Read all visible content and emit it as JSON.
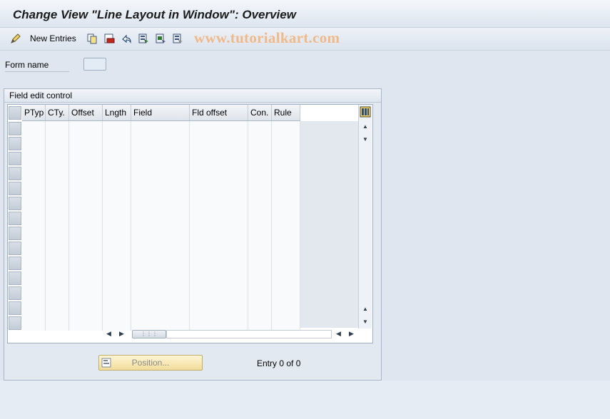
{
  "window": {
    "title": "Change View \"Line Layout in Window\": Overview"
  },
  "toolbar": {
    "new_entries_label": "New Entries",
    "icons": [
      "edit-pen-icon",
      "copy-icon",
      "delete-icon",
      "undo-icon",
      "select-all-icon",
      "select-block-icon",
      "deselect-all-icon"
    ]
  },
  "watermark": {
    "text": "www.tutorialkart.com",
    "color": "#f0b98a"
  },
  "form": {
    "form_name_label": "Form name",
    "form_name_value": ""
  },
  "group": {
    "title": "Field edit control"
  },
  "table": {
    "columns": [
      {
        "key": "ptyp",
        "label": "PTyp"
      },
      {
        "key": "cty",
        "label": "CTy."
      },
      {
        "key": "offset",
        "label": "Offset"
      },
      {
        "key": "lngth",
        "label": "Lngth"
      },
      {
        "key": "field",
        "label": "Field"
      },
      {
        "key": "fld_offset",
        "label": "Fld offset"
      },
      {
        "key": "con",
        "label": "Con."
      },
      {
        "key": "rule",
        "label": "Rule"
      }
    ],
    "rows": [
      [
        "",
        "",
        "",
        "",
        "",
        "",
        "",
        ""
      ],
      [
        "",
        "",
        "",
        "",
        "",
        "",
        "",
        ""
      ],
      [
        "",
        "",
        "",
        "",
        "",
        "",
        "",
        ""
      ],
      [
        "",
        "",
        "",
        "",
        "",
        "",
        "",
        ""
      ],
      [
        "",
        "",
        "",
        "",
        "",
        "",
        "",
        ""
      ],
      [
        "",
        "",
        "",
        "",
        "",
        "",
        "",
        ""
      ],
      [
        "",
        "",
        "",
        "",
        "",
        "",
        "",
        ""
      ],
      [
        "",
        "",
        "",
        "",
        "",
        "",
        "",
        ""
      ],
      [
        "",
        "",
        "",
        "",
        "",
        "",
        "",
        ""
      ],
      [
        "",
        "",
        "",
        "",
        "",
        "",
        "",
        ""
      ],
      [
        "",
        "",
        "",
        "",
        "",
        "",
        "",
        ""
      ],
      [
        "",
        "",
        "",
        "",
        "",
        "",
        "",
        ""
      ],
      [
        "",
        "",
        "",
        "",
        "",
        "",
        "",
        ""
      ],
      [
        "",
        "",
        "",
        "",
        "",
        "",
        "",
        ""
      ]
    ]
  },
  "footer": {
    "position_label": "Position...",
    "entry_count": "Entry 0 of 0"
  },
  "colors": {
    "background": "#dfe6ef",
    "position_button": "#f1dc99"
  }
}
